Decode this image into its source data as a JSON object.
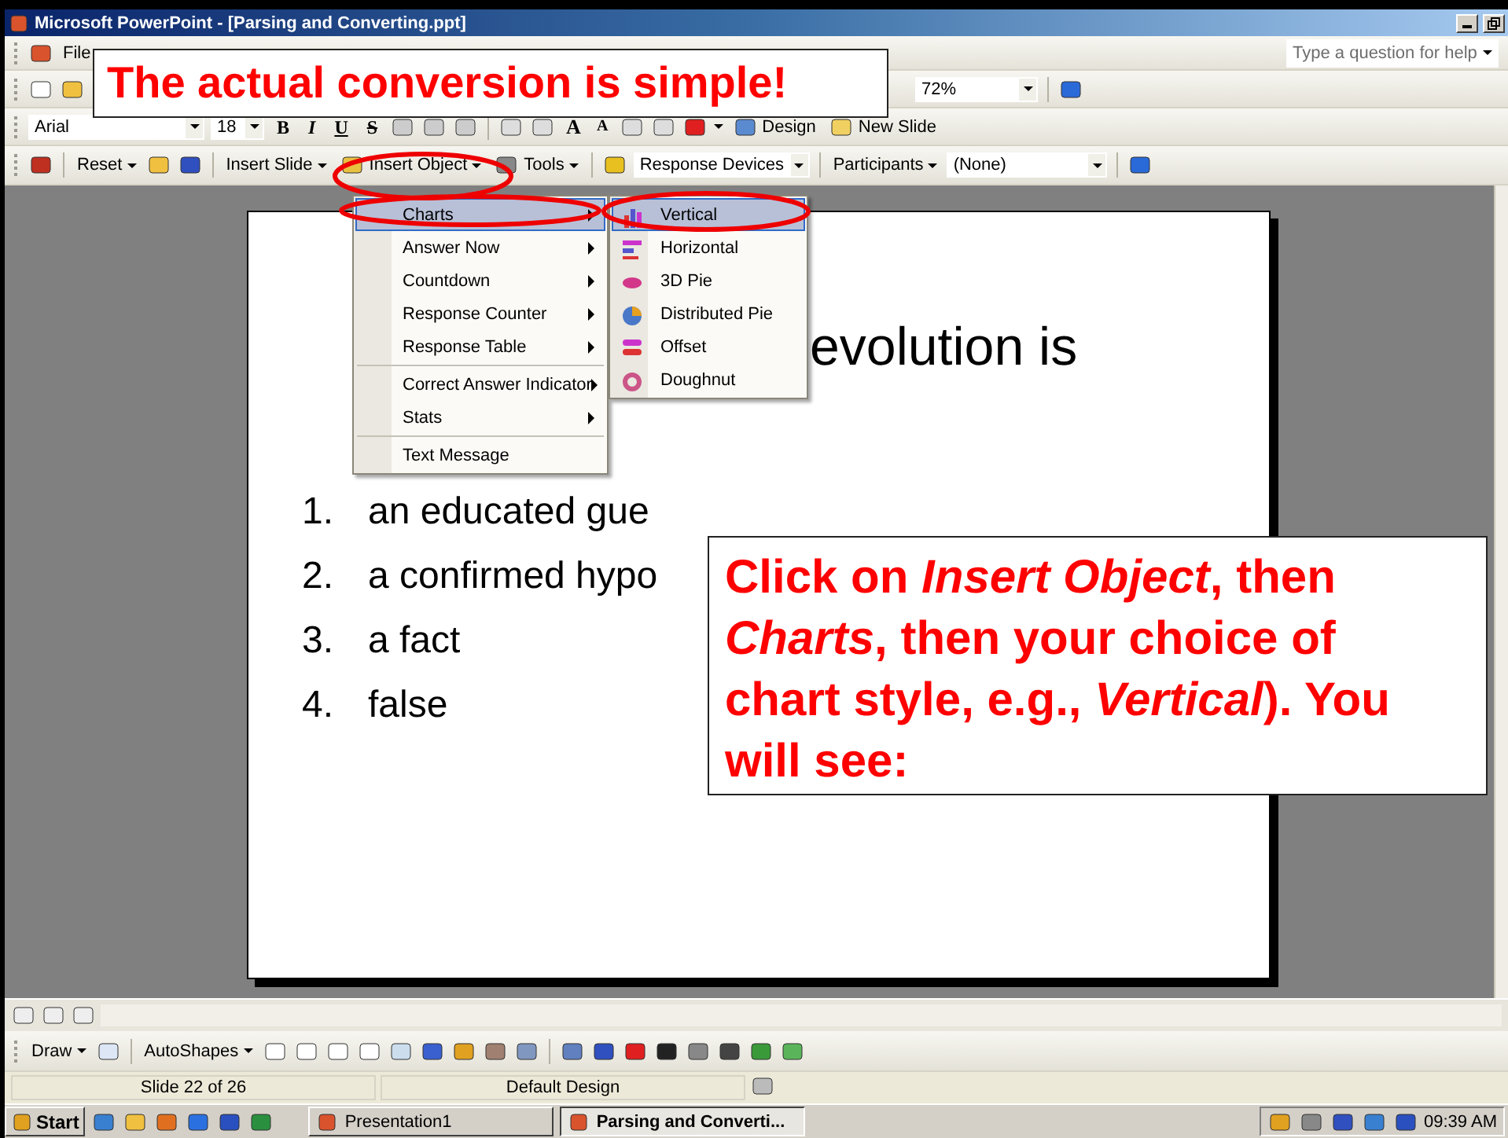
{
  "window": {
    "title": "Microsoft PowerPoint - [Parsing and Converting.ppt]",
    "help_placeholder": "Type a question for help"
  },
  "menu_bar": [
    "File"
  ],
  "standard_toolbar": {
    "zoom": "72%"
  },
  "formatting_toolbar": {
    "font": "Arial",
    "size": "18",
    "style_buttons": [
      "B",
      "I",
      "U",
      "S"
    ],
    "size_buttons": [
      "A",
      "A"
    ],
    "buttons": [
      "Design",
      "New Slide"
    ]
  },
  "response_toolbar": {
    "reset": "Reset",
    "insert_slide": "Insert Slide",
    "insert_object": "Insert Object",
    "tools": "Tools",
    "devices": "Response Devices",
    "participants": "Participants",
    "participant_value": "(None)"
  },
  "insert_object_menu": [
    {
      "label": "Charts",
      "submenu": true,
      "separator_before": false,
      "selected": true
    },
    {
      "label": "Answer Now",
      "submenu": true,
      "separator_before": false,
      "selected": false
    },
    {
      "label": "Countdown",
      "submenu": true,
      "separator_before": false,
      "selected": false
    },
    {
      "label": "Response Counter",
      "submenu": true,
      "separator_before": false,
      "selected": false
    },
    {
      "label": "Response Table",
      "submenu": true,
      "separator_before": false,
      "selected": false
    },
    {
      "label": "Correct Answer Indicator",
      "submenu": true,
      "separator_before": true,
      "selected": false
    },
    {
      "label": "Stats",
      "submenu": true,
      "separator_before": false,
      "selected": false
    },
    {
      "label": "Text Message",
      "submenu": false,
      "separator_before": true,
      "selected": false
    }
  ],
  "charts_submenu": [
    {
      "label": "Vertical",
      "kind": "vertical",
      "selected": true
    },
    {
      "label": "Horizontal",
      "kind": "horizontal",
      "selected": false
    },
    {
      "label": "3D Pie",
      "kind": "pie3d",
      "selected": false
    },
    {
      "label": "Distributed Pie",
      "kind": "pie",
      "selected": false
    },
    {
      "label": "Offset",
      "kind": "offset",
      "selected": false
    },
    {
      "label": "Doughnut",
      "kind": "doughnut",
      "selected": false
    }
  ],
  "slide": {
    "title": "evolution is",
    "options": [
      {
        "number": "1.",
        "text": "an educated gue"
      },
      {
        "number": "2.",
        "text": "a confirmed hypo"
      },
      {
        "number": "3.",
        "text": "a fact"
      },
      {
        "number": "4.",
        "text": "false"
      }
    ]
  },
  "callouts": [
    {
      "kind": "banner",
      "text": "The actual conversion is simple!"
    },
    {
      "kind": "note",
      "text": "Click on *Insert Object*, then *Charts*, then your choice of chart style, e.g., *Vertical*). You will see:"
    }
  ],
  "drawing_toolbar": {
    "draw": "Draw",
    "autoshapes": "AutoShapes"
  },
  "status_bar": {
    "slide": "Slide 22 of 26",
    "design": "Default Design"
  },
  "taskbar": {
    "start": "Start",
    "windows": [
      {
        "label": "Presentation1",
        "selected": false
      },
      {
        "label": "Parsing and Converti...",
        "selected": true
      }
    ],
    "clock": "09:39 AM"
  }
}
